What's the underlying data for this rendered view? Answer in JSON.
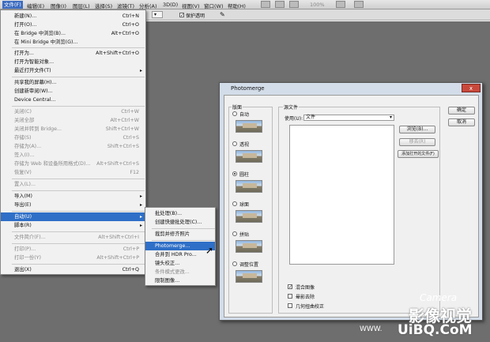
{
  "menubar": {
    "items": [
      "文件(F)",
      "编辑(E)",
      "图像(I)",
      "图层(L)",
      "选择(S)",
      "滤镜(T)",
      "分析(A)",
      "3D(D)",
      "视图(V)",
      "窗口(W)",
      "帮助(H)"
    ]
  },
  "toolbar": {
    "zoom_label": "100%",
    "protect_label": "保护透明"
  },
  "file_menu": {
    "items": [
      {
        "label": "新建(N)...",
        "shortcut": "Ctrl+N"
      },
      {
        "label": "打开(O)...",
        "shortcut": "Ctrl+O"
      },
      {
        "label": "在 Bridge 中浏览(B)...",
        "shortcut": "Alt+Ctrl+O"
      },
      {
        "label": "在 Mini Bridge 中浏览(G)...",
        "shortcut": ""
      },
      {
        "label": "打开为...",
        "shortcut": "Alt+Shift+Ctrl+O"
      },
      {
        "label": "打开为智能对象...",
        "shortcut": ""
      },
      {
        "label": "最近打开文件(T)",
        "shortcut": ""
      },
      {
        "label": "共享我的屏幕(H)...",
        "shortcut": ""
      },
      {
        "label": "创建新审阅(W)...",
        "shortcut": ""
      },
      {
        "label": "Device Central...",
        "shortcut": ""
      },
      {
        "label": "关闭(C)",
        "shortcut": "Ctrl+W"
      },
      {
        "label": "关闭全部",
        "shortcut": "Alt+Ctrl+W"
      },
      {
        "label": "关闭并转到 Bridge...",
        "shortcut": "Shift+Ctrl+W"
      },
      {
        "label": "存储(S)",
        "shortcut": "Ctrl+S"
      },
      {
        "label": "存储为(A)...",
        "shortcut": "Shift+Ctrl+S"
      },
      {
        "label": "签入(I)...",
        "shortcut": ""
      },
      {
        "label": "存储为 Web 和设备所用格式(D)...",
        "shortcut": "Alt+Shift+Ctrl+S"
      },
      {
        "label": "恢复(V)",
        "shortcut": "F12"
      },
      {
        "label": "置入(L)...",
        "shortcut": ""
      },
      {
        "label": "导入(M)",
        "shortcut": ""
      },
      {
        "label": "导出(E)",
        "shortcut": ""
      },
      {
        "label": "自动(U)",
        "shortcut": ""
      },
      {
        "label": "脚本(R)",
        "shortcut": ""
      },
      {
        "label": "文件简介(F)...",
        "shortcut": "Alt+Shift+Ctrl+I"
      },
      {
        "label": "打印(P)...",
        "shortcut": "Ctrl+P"
      },
      {
        "label": "打印一份(Y)",
        "shortcut": "Alt+Shift+Ctrl+P"
      },
      {
        "label": "退出(X)",
        "shortcut": "Ctrl+Q"
      }
    ]
  },
  "auto_submenu": {
    "items": [
      "批处理(B)...",
      "创建快捷批处理(C)...",
      "裁剪并修齐照片",
      "Photomerge...",
      "合并到 HDR Pro...",
      "镜头校正...",
      "条件模式更改...",
      "限制图像..."
    ]
  },
  "dialog": {
    "title": "Photomerge",
    "close_label": "x",
    "layout_group": "版面",
    "layouts": [
      "自动",
      "透视",
      "圆柱",
      "球面",
      "拼贴",
      "调整位置"
    ],
    "source_group": "源文件",
    "use_label": "使用(U):",
    "use_value": "文件",
    "buttons": [
      "浏览(B)...",
      "移去(R)",
      "添加打开的文件(F)"
    ],
    "ok": "确定",
    "cancel": "取消",
    "options": [
      "混合图像",
      "晕影去除",
      "几何扭曲校正"
    ]
  },
  "watermark": {
    "brand1": "Camera",
    "brand2": "影像视觉",
    "site": "UiBQ.CoM",
    "small": "WWW."
  }
}
